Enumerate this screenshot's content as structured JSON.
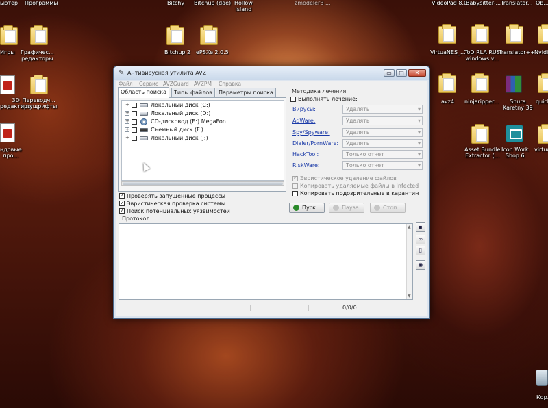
{
  "desktop": {
    "top_labels": [
      "ьютер",
      "Программы",
      "Bitchy",
      "Bitchup (dae)",
      "Hollow\nIsland",
      "zmodeler3 ...",
      "VideoPad 8.0",
      "Babysitter-...",
      "Translator...",
      "Ob..."
    ],
    "left_icons": [
      "Игры",
      "Графичес...\nредакторы",
      "3D\nредакторы",
      "Переводч...\nи пущрифты",
      "ндовые\nпро..."
    ],
    "mid_icons": [
      "Bitchup 2",
      "ePSXe 2.0.5"
    ],
    "right_icons": [
      "VirtuaNES_...",
      "ToD RLA RUS\nwindows v...",
      "Translator++",
      "Nvidi...",
      "avz4",
      "ninjaripper...",
      "Shura\nKaretny 39",
      "quick...",
      "Asset Bundle\nExtractor (...",
      "Icon Work\nShop 6",
      "virtua...",
      "Кор..."
    ]
  },
  "window": {
    "title": "Антивирусная утилита AVZ",
    "buttons": {
      "minimize": "▭",
      "maximize": "□",
      "close": "✕"
    },
    "menu": [
      "Файл",
      "Сервис",
      "AVZGuard",
      "AVZPM",
      "Справка"
    ],
    "tabs": [
      "Область поиска",
      "Типы файлов",
      "Параметры поиска"
    ],
    "drives": [
      {
        "label": "Локальный диск (C:)",
        "type": "hdd"
      },
      {
        "label": "Локальный диск (D:)",
        "type": "hdd"
      },
      {
        "label": "CD-дисковод (E:) MegaFon",
        "type": "cd"
      },
      {
        "label": "Съемный диск (F:)",
        "type": "removable"
      },
      {
        "label": "Локальный диск (J:)",
        "type": "hdd"
      }
    ],
    "options": [
      "Проверять запущенные процессы",
      "Эвристическая проверка системы",
      "Поиск потенциальных уязвимостей"
    ],
    "treatment": {
      "title": "Методика лечения",
      "perform_label": "Выполнять лечение:",
      "threats": [
        {
          "name": "Вирусы:",
          "action": "Удалять"
        },
        {
          "name": "AdWare:",
          "action": "Удалять"
        },
        {
          "name": "Spy/Spyware:",
          "action": "Удалять"
        },
        {
          "name": "Dialer/PornWare:",
          "action": "Удалять"
        },
        {
          "name": "HackTool:",
          "action": "Только отчет"
        },
        {
          "name": "RiskWare:",
          "action": "Только отчет"
        }
      ],
      "heuristic_delete": "Эвристическое удаление файлов",
      "copy_deleted": "Копировать удаляемые файлы в  Infected",
      "copy_suspicious": "Копировать подозрительные в  карантин"
    },
    "actions": {
      "start": "Пуск",
      "pause": "Пауза",
      "stop": "Стоп"
    },
    "protocol_label": "Протокол",
    "status": "0/0/0"
  }
}
